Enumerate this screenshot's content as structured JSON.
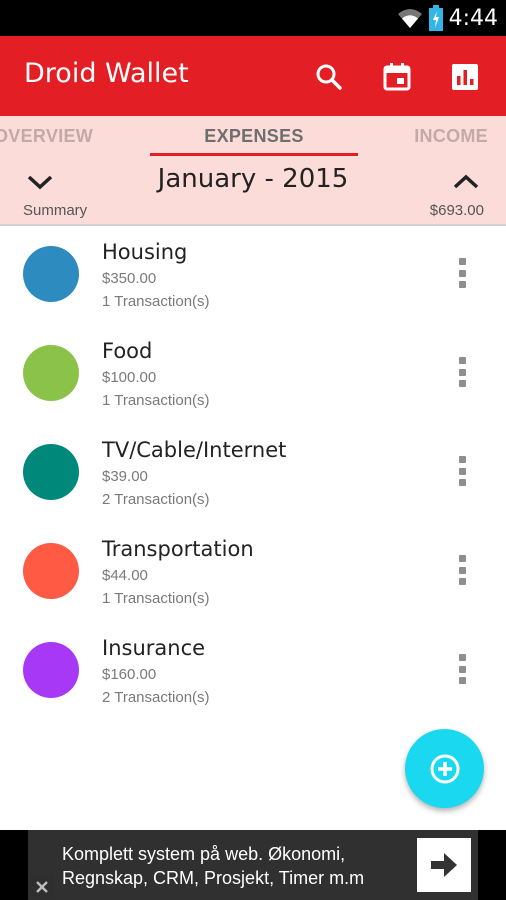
{
  "status_bar": {
    "time": "4:44",
    "icons": [
      "wifi-icon",
      "battery-icon"
    ]
  },
  "app_bar": {
    "title": "Droid Wallet",
    "actions": [
      "search-icon",
      "calendar-icon",
      "chart-icon"
    ],
    "color": "#e31e24"
  },
  "tabs": [
    {
      "label": "OVERVIEW",
      "active": false
    },
    {
      "label": "EXPENSES",
      "active": true
    },
    {
      "label": "INCOME",
      "active": false
    }
  ],
  "period": {
    "month_label": "January - 2015",
    "summary_label": "Summary",
    "summary_total": "$693.00"
  },
  "categories": [
    {
      "name": "Housing",
      "amount": "$350.00",
      "transactions": "1 Transaction(s)",
      "color": "#2e8bc0"
    },
    {
      "name": "Food",
      "amount": "$100.00",
      "transactions": "1 Transaction(s)",
      "color": "#8bc34a"
    },
    {
      "name": "TV/Cable/Internet",
      "amount": "$39.00",
      "transactions": "2 Transaction(s)",
      "color": "#00897b"
    },
    {
      "name": "Transportation",
      "amount": "$44.00",
      "transactions": "1 Transaction(s)",
      "color": "#ff5a44"
    },
    {
      "name": "Insurance",
      "amount": "$160.00",
      "transactions": "2 Transaction(s)",
      "color": "#a638f6"
    }
  ],
  "fab": {
    "icon": "add-circle-icon",
    "color": "#1ad8ef"
  },
  "ad": {
    "line1": "Komplett system på web. Økonomi,",
    "line2": "Regnskap, CRM, Prosjekt, Timer m.m"
  }
}
